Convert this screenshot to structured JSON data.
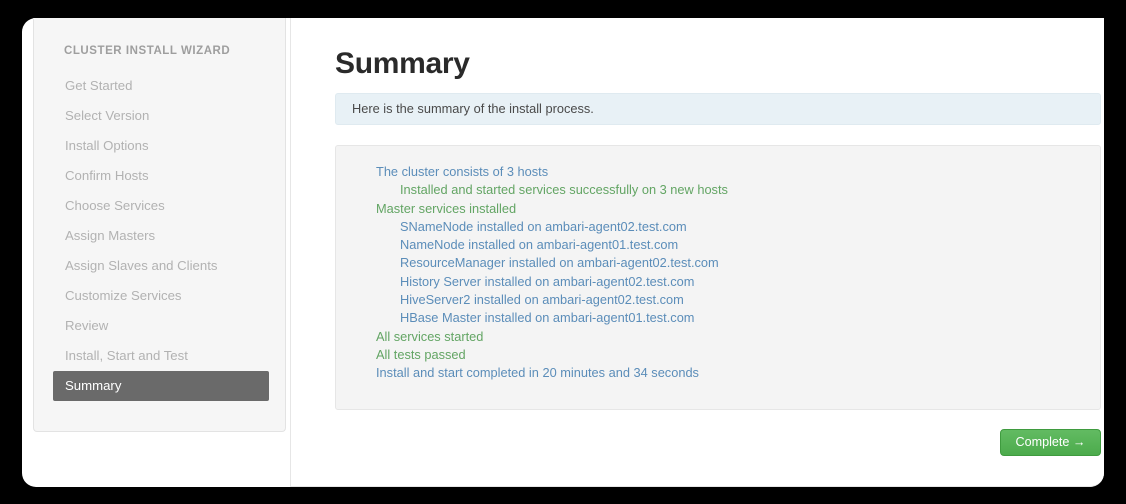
{
  "sidebar": {
    "title": "CLUSTER INSTALL WIZARD",
    "items": [
      {
        "label": "Get Started",
        "active": false
      },
      {
        "label": "Select Version",
        "active": false
      },
      {
        "label": "Install Options",
        "active": false
      },
      {
        "label": "Confirm Hosts",
        "active": false
      },
      {
        "label": "Choose Services",
        "active": false
      },
      {
        "label": "Assign Masters",
        "active": false
      },
      {
        "label": "Assign Slaves and Clients",
        "active": false
      },
      {
        "label": "Customize Services",
        "active": false
      },
      {
        "label": "Review",
        "active": false
      },
      {
        "label": "Install, Start and Test",
        "active": false
      },
      {
        "label": "Summary",
        "active": true
      }
    ]
  },
  "main": {
    "page_title": "Summary",
    "alert_text": "Here is the summary of the install process.",
    "summary_lines": [
      {
        "text": "The cluster consists of 3 hosts",
        "color": "blue",
        "indent": 0
      },
      {
        "text": "Installed and started services successfully on 3 new hosts",
        "color": "green",
        "indent": 1
      },
      {
        "text": "Master services installed",
        "color": "green",
        "indent": 0
      },
      {
        "text": "SNameNode installed on ambari-agent02.test.com",
        "color": "blue",
        "indent": 1
      },
      {
        "text": "NameNode installed on ambari-agent01.test.com",
        "color": "blue",
        "indent": 1
      },
      {
        "text": "ResourceManager installed on ambari-agent02.test.com",
        "color": "blue",
        "indent": 1
      },
      {
        "text": "History Server installed on ambari-agent02.test.com",
        "color": "blue",
        "indent": 1
      },
      {
        "text": "HiveServer2 installed on ambari-agent02.test.com",
        "color": "blue",
        "indent": 1
      },
      {
        "text": "HBase Master installed on ambari-agent01.test.com",
        "color": "blue",
        "indent": 1
      },
      {
        "text": "All services started",
        "color": "green",
        "indent": 0
      },
      {
        "text": "All tests passed",
        "color": "green",
        "indent": 0
      },
      {
        "text": "Install and start completed in 20 minutes and 34 seconds",
        "color": "blue",
        "indent": 0
      }
    ],
    "complete_button": "Complete →"
  },
  "colors": {
    "blue_text": "#5b8db9",
    "green_text": "#63a564",
    "active_nav_bg": "#6a6a6a",
    "button_green": "#4cab4c",
    "alert_bg": "#e8f1f6"
  }
}
